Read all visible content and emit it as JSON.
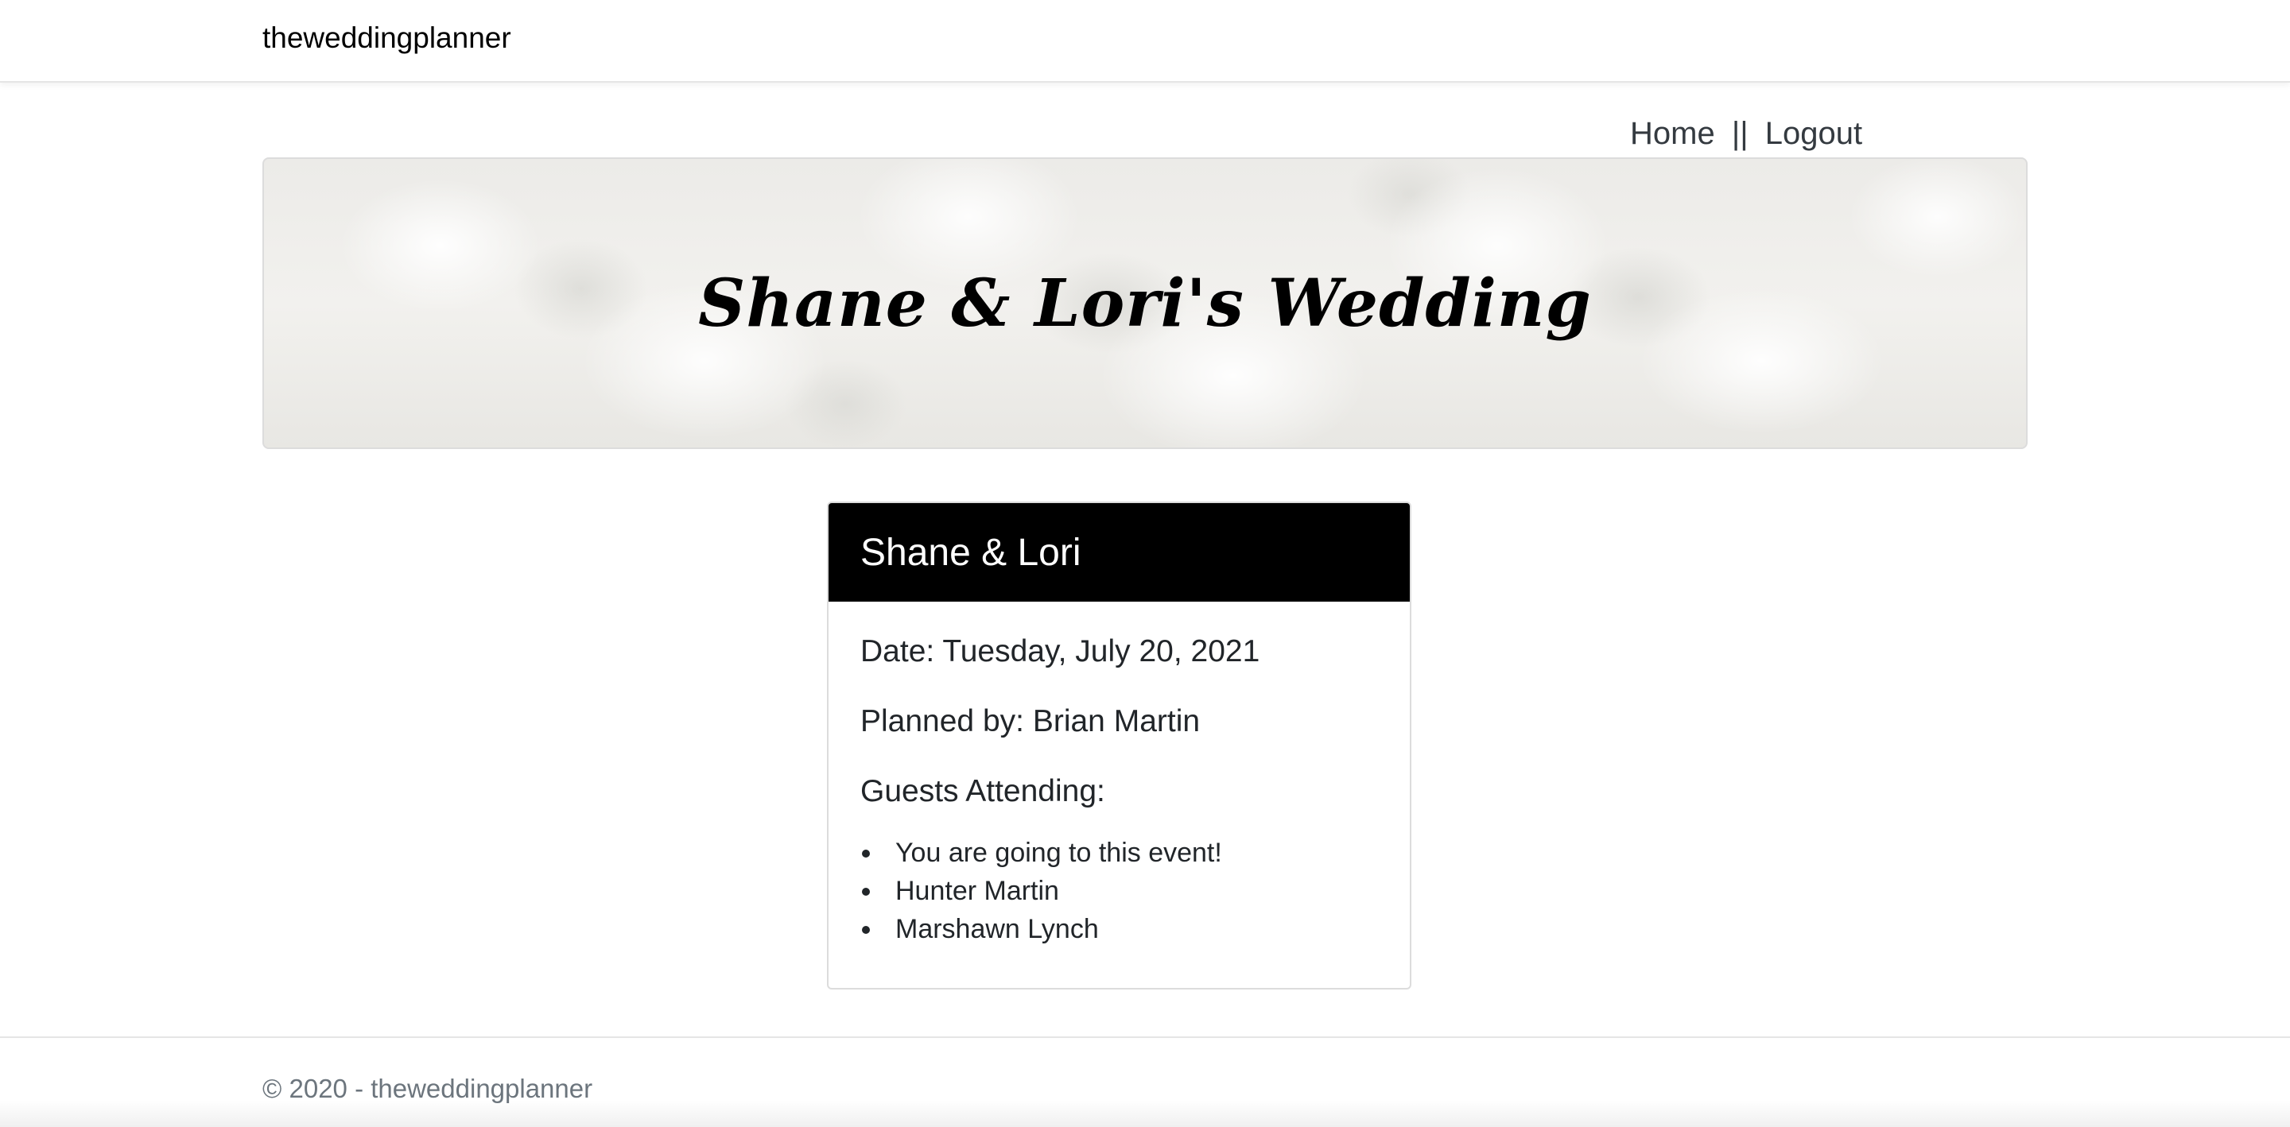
{
  "navbar": {
    "brand": "theweddingplanner"
  },
  "topnav": {
    "home": "Home",
    "separator": "||",
    "logout": "Logout"
  },
  "banner": {
    "title": "Shane & Lori's Wedding"
  },
  "card": {
    "header": "Shane & Lori",
    "date_line": "Date: Tuesday, July 20, 2021",
    "planner_line": "Planned by: Brian Martin",
    "guests_heading": "Guests Attending:",
    "guests": [
      "You are going to this event!",
      "Hunter Martin",
      "Marshawn Lynch"
    ]
  },
  "footer": {
    "text": "© 2020 - theweddingplanner"
  },
  "colors": {
    "card_header_bg": "#000000",
    "card_header_text": "#ffffff",
    "footer_text": "#6c757d"
  }
}
